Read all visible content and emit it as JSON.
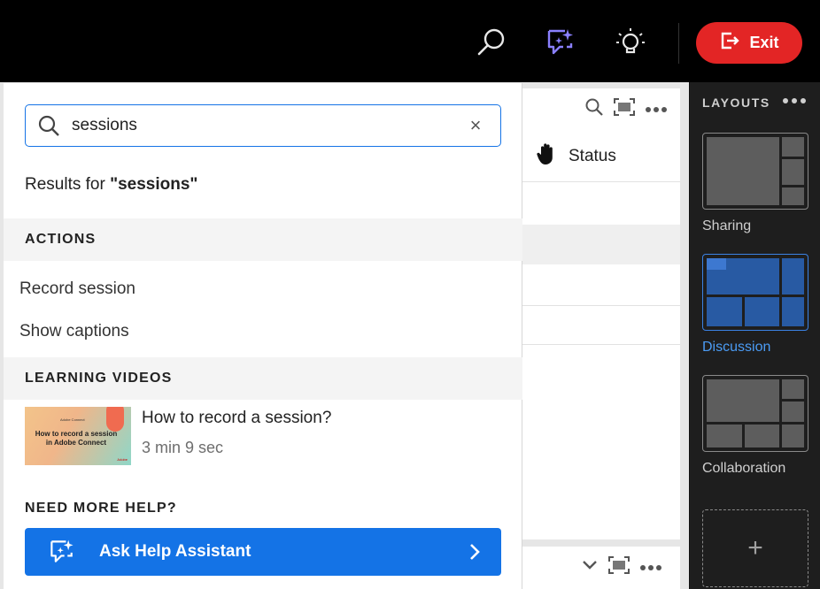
{
  "topbar": {
    "exit_label": "Exit",
    "icons": [
      "search-icon",
      "help-assistant-icon",
      "lightbulb-icon",
      "exit-icon"
    ],
    "colors": {
      "exit": "#e32525",
      "assistant_icon": "#7b74ff"
    }
  },
  "search": {
    "value": "sessions",
    "placeholder": "",
    "results_prefix": "Results for ",
    "results_term": "\"sessions\""
  },
  "actions": {
    "header": "ACTIONS",
    "items": [
      "Record session",
      "Show captions"
    ]
  },
  "learning": {
    "header": "LEARNING VIDEOS",
    "video": {
      "title": "How to record a session?",
      "duration": "3 min 9 sec",
      "thumb_title": "How to record a session in Adobe Connect",
      "thumb_brand": "Adobe Connect",
      "thumb_corner": "Adobe"
    }
  },
  "help": {
    "header": "NEED MORE HELP?",
    "button_label": "Ask Help Assistant",
    "color": "#1473e6"
  },
  "pod": {
    "status_label": "Status"
  },
  "layouts": {
    "header": "LAYOUTS",
    "items": [
      {
        "label": "Sharing",
        "selected": false
      },
      {
        "label": "Discussion",
        "selected": true
      },
      {
        "label": "Collaboration",
        "selected": false
      }
    ],
    "add_label": "+"
  }
}
